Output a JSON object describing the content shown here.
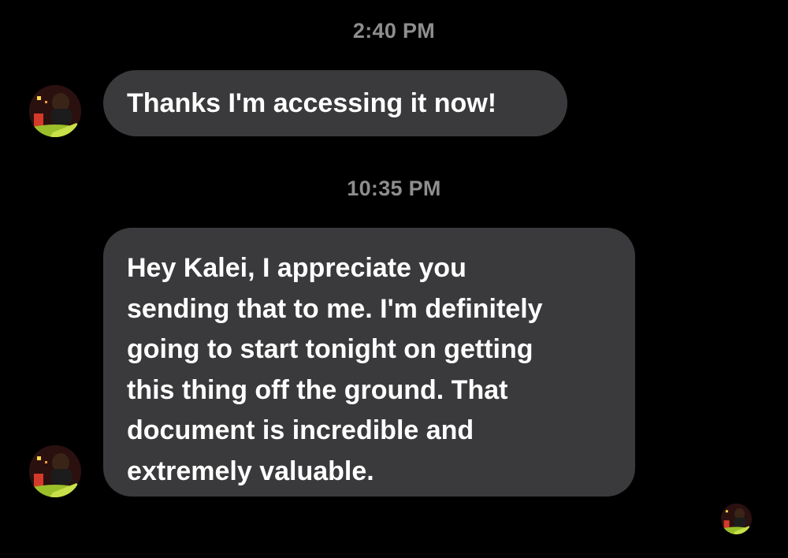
{
  "conversation": {
    "messages": [
      {
        "timestamp": "2:40 PM",
        "lines": [
          "Thanks I'm accessing it now!"
        ]
      },
      {
        "timestamp": "10:35 PM",
        "lines": [
          "Hey Kalei, I appreciate you",
          "sending that to me. I'm definitely",
          "going to start tonight on getting",
          "this thing off the ground. That",
          "document is incredible and",
          "extremely valuable."
        ]
      }
    ]
  },
  "colors": {
    "background": "#000000",
    "bubble": "#3a3a3c",
    "timestamp": "#8e8e8e",
    "text": "#ffffff"
  },
  "icons": {
    "sender_avatar": "profile-photo",
    "seen_indicator": "read-receipt-avatar"
  }
}
